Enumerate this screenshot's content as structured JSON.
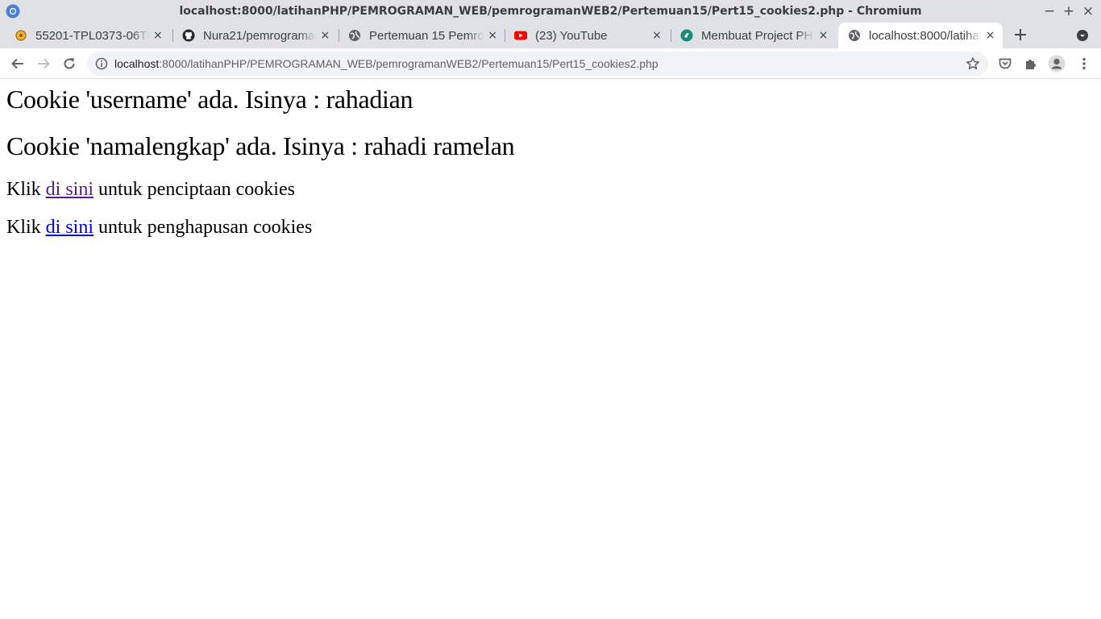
{
  "window": {
    "title": "localhost:8000/latihanPHP/PEMROGRAMAN_WEB/pemrogramanWEB2/Pertemuan15/Pert15_cookies2.php - Chromium",
    "controls": {
      "minimize": "−",
      "maximize": "+",
      "close": "×"
    }
  },
  "tabs": [
    {
      "title": "55201-TPL0373-06TPL",
      "icon": "moodle-icon",
      "active": false
    },
    {
      "title": "Nura21/pemrograman",
      "icon": "github-icon",
      "active": false
    },
    {
      "title": "Pertemuan 15 Pemrograman",
      "icon": "globe-icon",
      "active": false
    },
    {
      "title": "(23) YouTube",
      "icon": "youtube-icon",
      "active": false
    },
    {
      "title": "Membuat Project PHP",
      "icon": "site-icon",
      "active": false
    },
    {
      "title": "localhost:8000/latihanPHP",
      "icon": "globe-icon",
      "active": true
    }
  ],
  "tabstrip": {
    "new_tab": "+",
    "close_glyph": "×"
  },
  "address_bar": {
    "host": "localhost",
    "rest": ":8000/latihanPHP/PEMROGRAMAN_WEB/pemrogramanWEB2/Pertemuan15/Pert15_cookies2.php"
  },
  "page": {
    "heading1": "Cookie 'username' ada. Isinya : rahadian",
    "heading2": "Cookie 'namalengkap' ada. Isinya : rahadi ramelan",
    "line1": {
      "prefix": "Klik ",
      "link": "di sini",
      "suffix": " untuk penciptaan cookies"
    },
    "line2": {
      "prefix": "Klik ",
      "link": "di sini",
      "suffix": " untuk penghapusan cookies"
    }
  },
  "colors": {
    "chrome_frame": "#dfe1e5",
    "omnibox_bg": "#f1f3f4",
    "link_visited": "#551a8b",
    "link_unvisited": "#0000ee",
    "youtube_red": "#ff0000"
  }
}
